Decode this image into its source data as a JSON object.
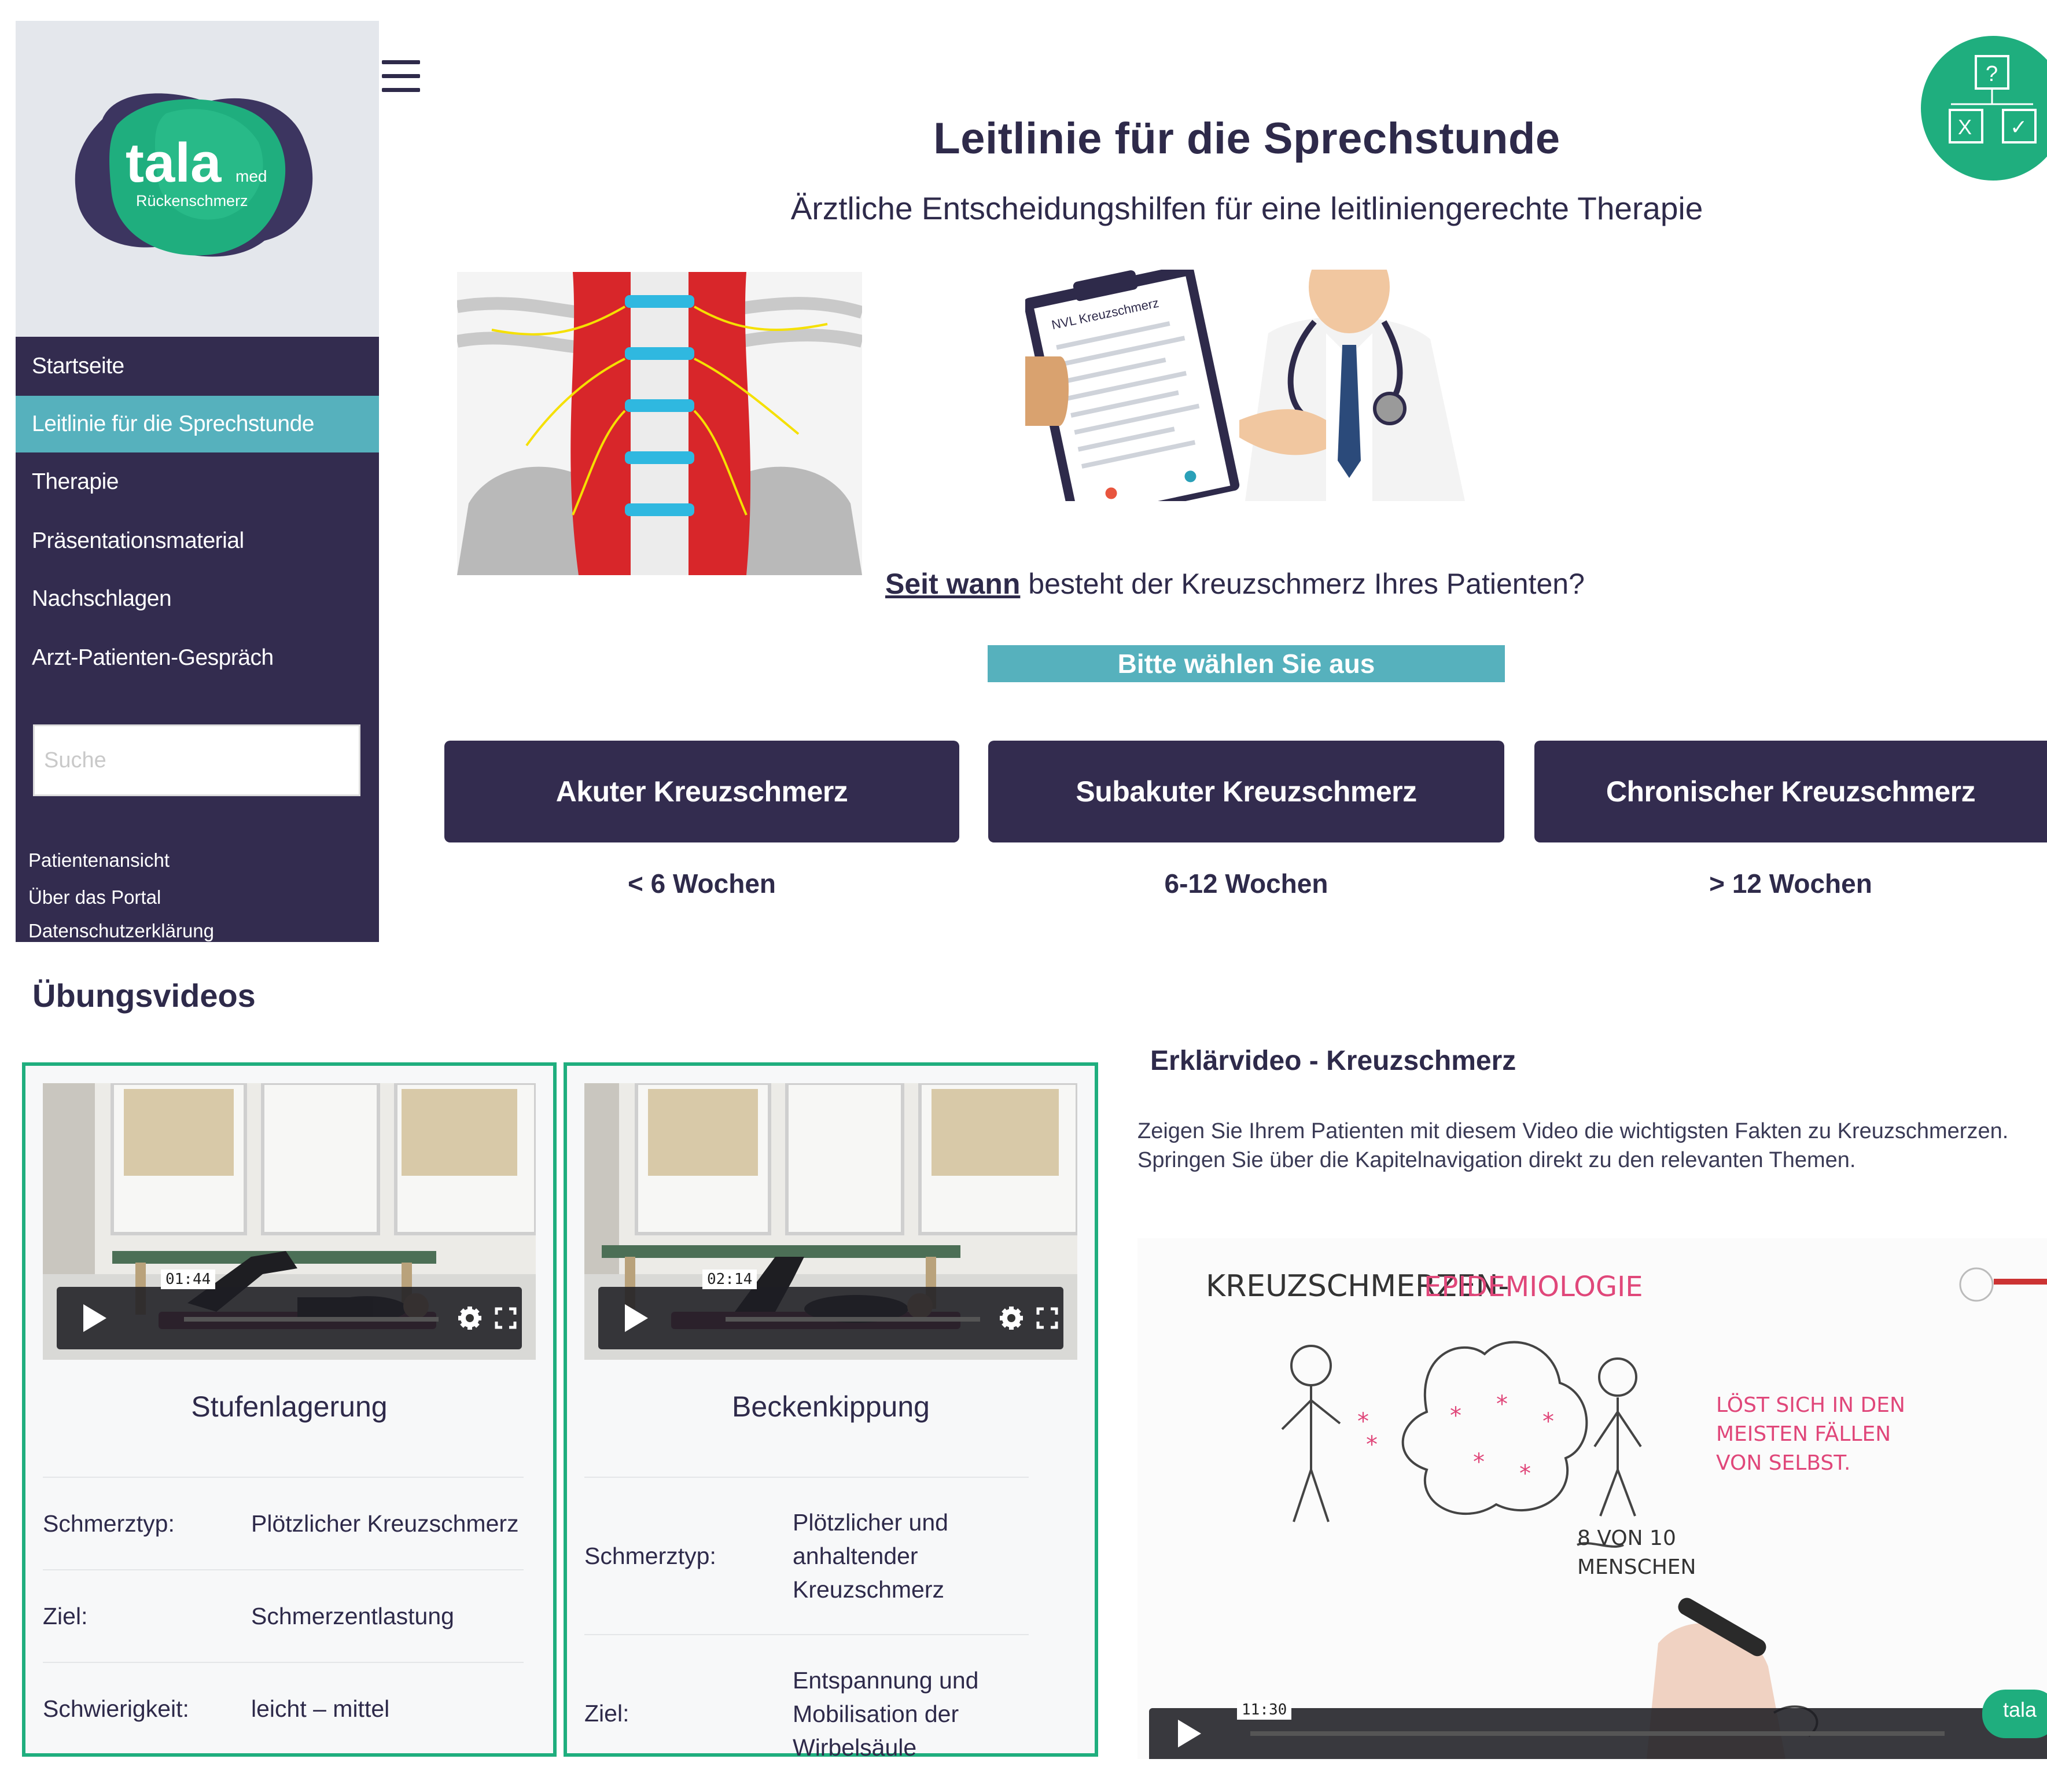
{
  "logo": {
    "brand": "tala",
    "sup": "med",
    "subtitle": "Rückenschmerz"
  },
  "nav": {
    "items": [
      {
        "label": "Startseite"
      },
      {
        "label": "Leitlinie für die Sprechstunde"
      },
      {
        "label": "Therapie"
      },
      {
        "label": "Präsentationsmaterial"
      },
      {
        "label": "Nachschlagen"
      },
      {
        "label": "Arzt-Patienten-Gespräch"
      }
    ],
    "active_index": 1,
    "search_placeholder": "Suche",
    "footer_links": [
      {
        "label": "Patientenansicht"
      },
      {
        "label": "Über das Portal"
      },
      {
        "label": "Datenschutzerklärung"
      }
    ]
  },
  "decision_icon": {
    "q": "?",
    "x": "X",
    "check": "✓"
  },
  "header": {
    "title": "Leitlinie für die Sprechstunde",
    "subtitle": "Ärztliche Entscheidungshilfen für eine leitliniengerechte Therapie"
  },
  "images": {
    "clipboard_label": "NVL Kreuzschmerz"
  },
  "question": {
    "emphasis": "Seit wann",
    "rest": " besteht der Kreuzschmerz Ihres Patienten?"
  },
  "select_label": "Bitte wählen Sie aus",
  "options": [
    {
      "label": "Akuter Kreuzschmerz",
      "duration": "< 6 Wochen"
    },
    {
      "label": "Subakuter Kreuzschmerz",
      "duration": "6-12 Wochen"
    },
    {
      "label": "Chronischer Kreuzschmerz",
      "duration": "> 12 Wochen"
    }
  ],
  "exercise_videos": {
    "heading": "Übungsvideos",
    "cards": [
      {
        "title": "Stufenlagerung",
        "time": "01:44",
        "rows": [
          {
            "label": "Schmerztyp:",
            "value": "Plötzlicher Kreuzschmerz"
          },
          {
            "label": "Ziel:",
            "value": "Schmerzentlastung"
          },
          {
            "label": "Schwierigkeit:",
            "value": "leicht – mittel"
          }
        ]
      },
      {
        "title": "Beckenkippung",
        "time": "02:14",
        "rows": [
          {
            "label": "Schmerztyp:",
            "value": "Plötzlicher und anhaltender Kreuzschmerz"
          },
          {
            "label": "Ziel:",
            "value": "Entspannung und Mobilisation der Wirbelsäule"
          }
        ]
      }
    ]
  },
  "explainer": {
    "heading": "Erklärvideo - Kreuzschmerz",
    "text_line1": "Zeigen Sie Ihrem Patienten mit diesem Video die wichtigsten Fakten zu Kreuzschmerzen.",
    "text_line2": "Springen Sie über die Kapitelnavigation direkt zu den relevanten Themen.",
    "video_title_a": "KREUZSCHMERZEN-",
    "video_title_b": "EPIDEMIOLOGIE",
    "note1": "LÖST SICH IN DEN",
    "note2": "MEISTEN FÄLLEN",
    "note3": "VON SELBST.",
    "stat1": "8 VON 10",
    "stat2": "MENSCHEN",
    "time": "11:30",
    "corner_badge": "tala"
  },
  "colors": {
    "navy": "#332c4f",
    "teal": "#56b1bd",
    "green": "#1fae7e",
    "sidebar_logo_bg": "#e4e7ec"
  }
}
